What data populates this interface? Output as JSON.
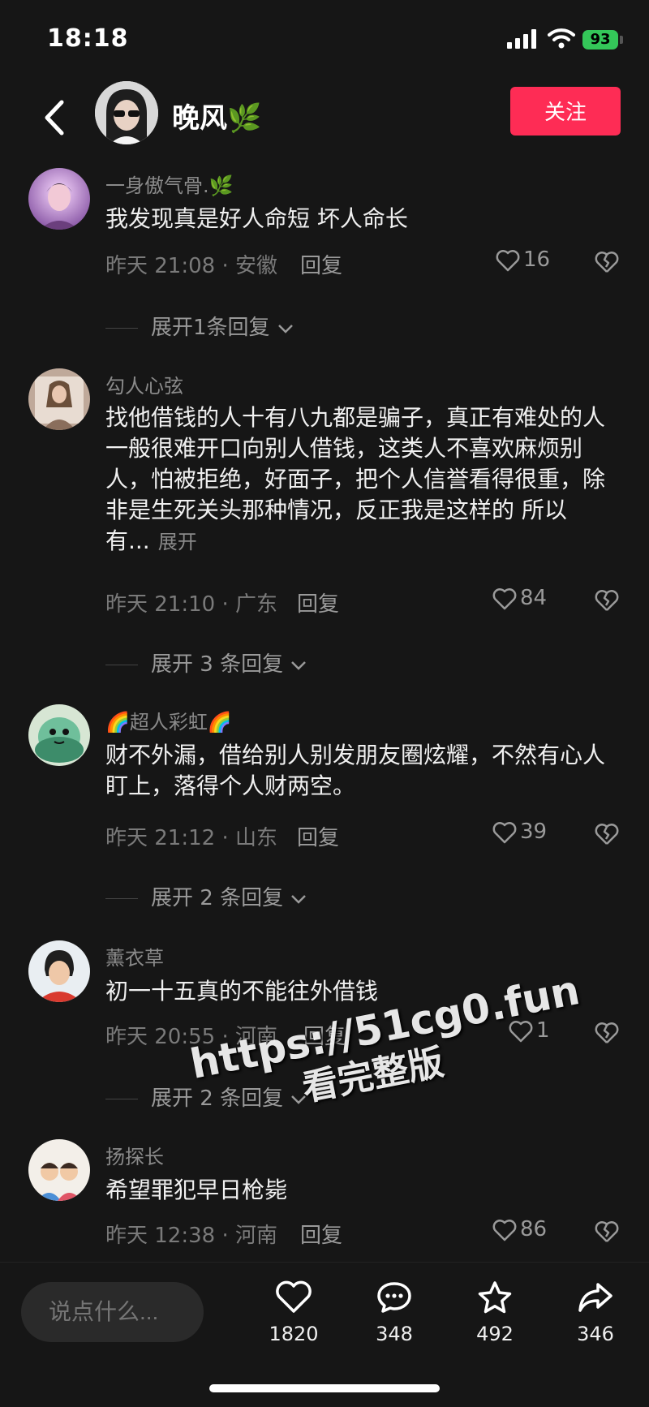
{
  "status_bar": {
    "time": "18:18",
    "battery": "93"
  },
  "header": {
    "username": "晚风🌿",
    "follow_label": "关注"
  },
  "comments": [
    {
      "username": "一身傲气骨.🌿",
      "text": "我发现真是好人命短  坏人命长",
      "meta": "昨天 21:08 · 安徽",
      "reply_label": "回复",
      "likes": "16",
      "more_replies": "展开1条回复"
    },
    {
      "username": "勾人心弦",
      "text": "找他借钱的人十有八九都是骗子，真正有难处的人一般很难开口向别人借钱，这类人不喜欢麻烦别人，怕被拒绝，好面子，把个人信誉看得很重，除非是生死关头那种情况，反正我是这样的 所以有...",
      "expand_label": "展开",
      "meta": "昨天 21:10 · 广东",
      "reply_label": "回复",
      "likes": "84",
      "more_replies": "展开 3 条回复"
    },
    {
      "username": "🌈超人彩虹🌈",
      "text": "财不外漏，借给别人别发朋友圈炫耀，不然有心人盯上，落得个人财两空。",
      "meta": "昨天 21:12 · 山东",
      "reply_label": "回复",
      "likes": "39",
      "more_replies": "展开 2 条回复"
    },
    {
      "username": "薰衣草",
      "text": "初一十五真的不能往外借钱",
      "meta": "昨天 20:55 · 河南",
      "reply_label": "回复",
      "likes": "1",
      "more_replies": "展开 2 条回复"
    },
    {
      "username": "扬探长",
      "text": "希望罪犯早日枪毙",
      "meta": "昨天 12:38 · 河南",
      "reply_label": "回复",
      "likes": "86"
    }
  ],
  "watermark": {
    "line1": "https://51cg0.fun",
    "line2": "看完整版"
  },
  "bottom_bar": {
    "input_placeholder": "说点什么...",
    "likes": "1820",
    "comments": "348",
    "favorites": "492",
    "shares": "346"
  },
  "colors": {
    "background": "#161616",
    "accent": "#fe2c55",
    "battery": "#34c759"
  },
  "icons": [
    "back-arrow-icon",
    "heart-icon",
    "broken-heart-icon",
    "chevron-down-icon",
    "comment-bubble-icon",
    "star-icon",
    "share-arrow-icon",
    "signal-icon",
    "wifi-icon"
  ]
}
